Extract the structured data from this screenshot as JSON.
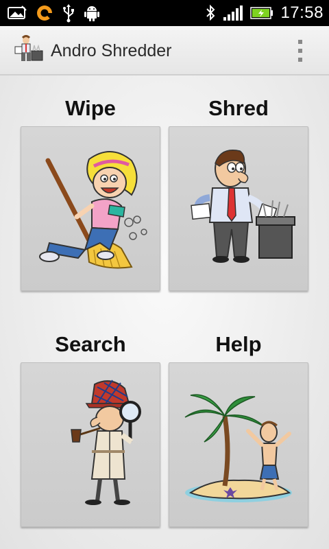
{
  "status_bar": {
    "time": "17:58",
    "left_icons": [
      "gallery-icon",
      "notification-ring-icon",
      "usb-icon",
      "android-debug-icon"
    ],
    "right_icons": [
      "bluetooth-icon",
      "signal-icon",
      "battery-charging-icon"
    ]
  },
  "action_bar": {
    "title": "Andro Shredder",
    "logo_icon": "app-logo-icon",
    "menu_icon": "overflow-menu-icon"
  },
  "tiles": [
    {
      "label": "Wipe",
      "icon": "wipe-girl-broom-illustration"
    },
    {
      "label": "Shred",
      "icon": "shred-man-paper-shredder-illustration"
    },
    {
      "label": "Search",
      "icon": "search-detective-magnifier-illustration"
    },
    {
      "label": "Help",
      "icon": "help-stranded-island-illustration"
    }
  ],
  "colors": {
    "status_bar": "#000000",
    "action_bar": "#efefef",
    "tile": "#d0d0d0",
    "battery_green": "#7ed321"
  }
}
